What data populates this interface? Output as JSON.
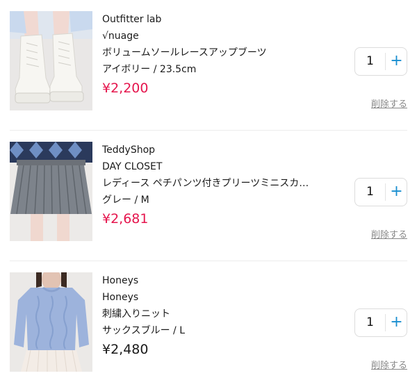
{
  "cart": {
    "items": [
      {
        "shop": "Outfitter lab",
        "brand": "√nuage",
        "name": "ボリュームソールレースアップブーツ",
        "variant": "アイボリー / 23.5cm",
        "price": "¥2,200",
        "price_style": "sale",
        "quantity": "1",
        "plus_label": "+",
        "delete_label": "削除する",
        "thumb_icon": "white-lace-up-boots-photo"
      },
      {
        "shop": "TeddyShop",
        "brand": "DAY CLOSET",
        "name": "レディース ペチパンツ付きプリーツミニスカ…",
        "variant": "グレー / M",
        "price": "¥2,681",
        "price_style": "sale",
        "quantity": "1",
        "plus_label": "+",
        "delete_label": "削除する",
        "thumb_icon": "gray-pleated-skirt-photo"
      },
      {
        "shop": "Honeys",
        "brand": "Honeys",
        "name": "刺繍入りニット",
        "variant": "サックスブルー / L",
        "price": "¥2,480",
        "price_style": "normal",
        "quantity": "1",
        "plus_label": "+",
        "delete_label": "削除する",
        "thumb_icon": "blue-cable-knit-sweater-photo"
      }
    ],
    "colors": {
      "sale_price": "#e5154d",
      "plus_button": "#1a8fd0",
      "delete_link": "#888888"
    }
  }
}
